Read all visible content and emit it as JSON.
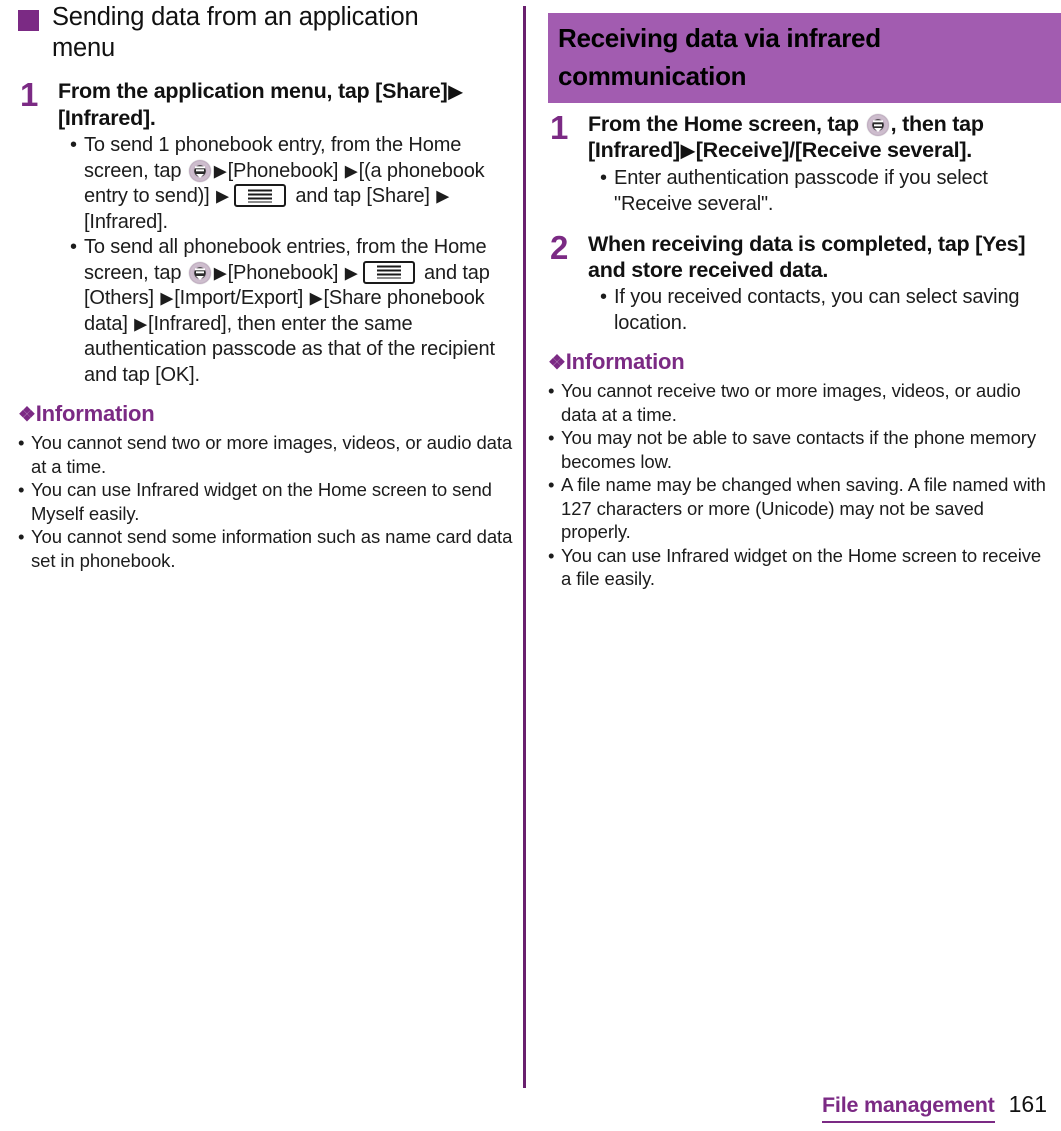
{
  "page": {
    "number": "161",
    "chapter": "File management",
    "accent_dark": "#7b2a84",
    "accent_bar": "#a25cb0"
  },
  "left_column": {
    "section_heading": "Sending data from an application menu",
    "step": {
      "number": "1",
      "title_part1": "From the application menu, tap [Share]",
      "title_arrow": "▶",
      "title_part2": "[Infrared].",
      "bullets": [
        {
          "id": "send-one-entry",
          "seg1": "To send 1 phonebook entry, from the Home screen, tap ",
          "icon1": "app-drawer-icon",
          "seg2": "[Phonebook] ",
          "seg3": "[(a phonebook entry to send)] ",
          "icon2": "menu-key-icon",
          "seg4": " and tap [Share] ",
          "seg5": "[Infrared]."
        },
        {
          "id": "send-all-entries",
          "seg1": "To send all phonebook entries, from the Home screen, tap ",
          "icon1": "app-drawer-icon",
          "seg2": "[Phonebook] ",
          "icon2": "menu-key-icon",
          "seg3": " and tap [Others] ",
          "seg4": "[Import/Export] ",
          "seg5": "[Share phonebook data] ",
          "seg6": "[Infrared], then enter the same authentication passcode as that of the recipient and tap [OK]."
        }
      ]
    },
    "information": {
      "heading": "Information",
      "diamond": "❖",
      "items": [
        "You cannot send two or more images, videos, or audio data at a time.",
        "You can use Infrared widget on the Home screen to send Myself easily.",
        "You cannot send some information such as name card data set in phonebook."
      ]
    }
  },
  "right_column": {
    "bar_heading": "Receiving data via infrared communication",
    "steps": [
      {
        "number": "1",
        "title_seg1": "From the Home screen, tap ",
        "icon": "app-drawer-icon",
        "title_seg2": ", then tap [Infrared]",
        "title_arrow": "▶",
        "title_seg3": "[Receive]/[Receive several].",
        "bullets": [
          "Enter authentication passcode if you select \"Receive several\"."
        ]
      },
      {
        "number": "2",
        "title": "When receiving data is completed, tap [Yes] and store received data.",
        "bullets": [
          "If you received contacts, you can select saving location."
        ]
      }
    ],
    "information": {
      "heading": "Information",
      "diamond": "❖",
      "items": [
        "You cannot receive two or more images, videos, or audio data at a time.",
        "You may not be able to save contacts if the phone memory becomes low.",
        "A file name may be changed when saving. A file named with 127 characters or more (Unicode) may not be saved properly.",
        "You can use Infrared widget on the Home screen to receive a file easily."
      ]
    }
  },
  "glyphs": {
    "bullet_dot": "•",
    "arrow": "▶"
  }
}
